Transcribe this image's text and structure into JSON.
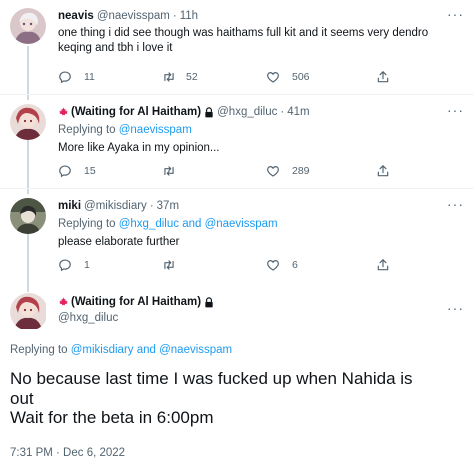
{
  "tweets": [
    {
      "name": "neavis",
      "handle": "@naevisspam",
      "dot": "·",
      "time": "11h",
      "text": "one thing i did see though was haithams full kit and it seems very dendro keqing and tbh i love it",
      "replies": "11",
      "retweets": "52",
      "likes": "506"
    },
    {
      "name": "(Waiting for Al Haitham)",
      "handle": "@hxg_diluc",
      "dot": "·",
      "time": "41m",
      "replying_prefix": "Replying to ",
      "replying_to": "@naevisspam",
      "text": "More like Ayaka in my opinion...",
      "replies": "15",
      "retweets": "",
      "likes": "289"
    },
    {
      "name": "miki",
      "handle": "@mikisdiary",
      "dot": "·",
      "time": "37m",
      "replying_prefix": "Replying to ",
      "replying_to": "@hxg_diluc and @naevisspam",
      "text": "please elaborate further",
      "replies": "1",
      "retweets": "",
      "likes": "6"
    }
  ],
  "main": {
    "name": "(Waiting for Al Haitham)",
    "handle": "@hxg_diluc",
    "replying_prefix": "Replying to ",
    "replying_to": "@mikisdiary and @naevisspam",
    "text_line1": "No because last time I was fucked up when Nahida is",
    "text_line2": "out",
    "text_line3": "Wait for the beta in 6:00pm",
    "timestamp": "7:31 PM · Dec 6, 2022"
  },
  "more_label": "···",
  "icons": [
    "more-icon",
    "reply-icon",
    "retweet-icon",
    "like-icon",
    "share-icon",
    "maple-leaf-icon",
    "lock-icon"
  ],
  "colors": {
    "link": "#1d9bf0",
    "secondary": "#536471",
    "leaf": "#e0245e",
    "line": "#cfd9de"
  }
}
